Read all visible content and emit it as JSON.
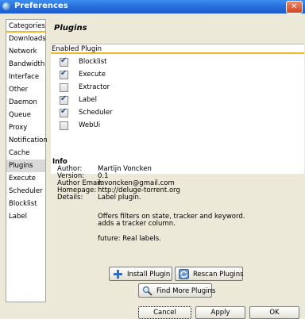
{
  "window": {
    "title": "Preferences",
    "close_symbol": "✕"
  },
  "sidebar": {
    "header": "Categories",
    "items": [
      "Downloads",
      "Network",
      "Bandwidth",
      "Interface",
      "Other",
      "Daemon",
      "Queue",
      "Proxy",
      "Notification",
      "Cache",
      "Plugins",
      "Execute",
      "Scheduler",
      "Blocklist",
      "Label"
    ],
    "selected": "Plugins"
  },
  "panel": {
    "title": "Plugins",
    "list_header": "Enabled Plugin",
    "plugins": [
      {
        "name": "Blocklist",
        "enabled": true
      },
      {
        "name": "Execute",
        "enabled": true
      },
      {
        "name": "Extractor",
        "enabled": false
      },
      {
        "name": "Label",
        "enabled": true
      },
      {
        "name": "Scheduler",
        "enabled": true
      },
      {
        "name": "WebUi",
        "enabled": false
      }
    ]
  },
  "info": {
    "title": "Info",
    "author_label": "Author:",
    "author": "Martijn Voncken",
    "version_label": "Version:",
    "version": "0.1",
    "email_label": "Author Email:",
    "email": "mvoncken@gmail.com",
    "homepage_label": "Homepage:",
    "homepage": "http://deluge-torrent.org",
    "details_label": "Details:",
    "details_lines": [
      "Label plugin.",
      "",
      "Offers filters on state, tracker and keyword.",
      "adds a tracker column.",
      "",
      "future: Real labels."
    ]
  },
  "buttons": {
    "install": "Install Plugin",
    "rescan": "Rescan Plugins",
    "find_more": "Find More Plugins",
    "cancel": "Cancel",
    "apply": "Apply",
    "ok": "OK"
  }
}
